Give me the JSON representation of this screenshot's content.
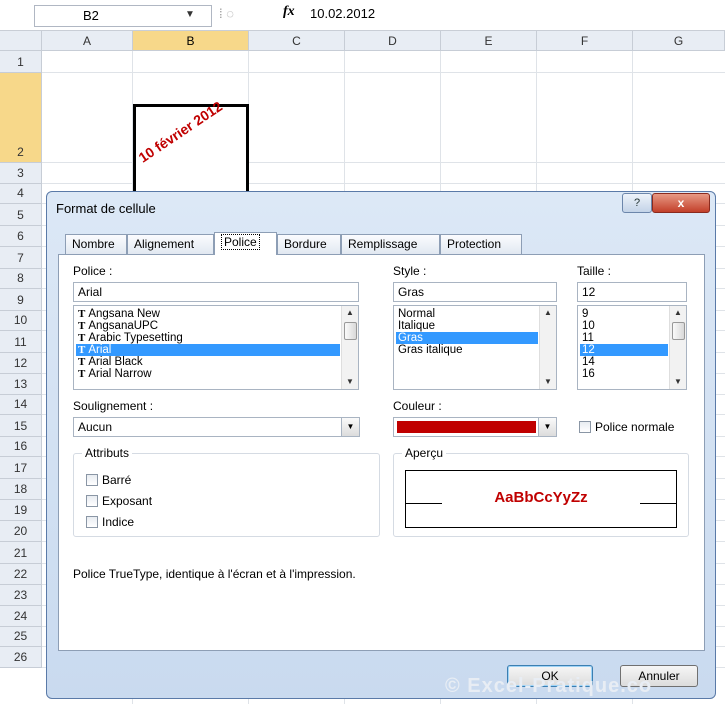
{
  "formula_bar": {
    "name_box": "B2",
    "fx_symbol": "fx",
    "formula": "10.02.2012"
  },
  "sheet": {
    "columns": [
      "A",
      "B",
      "C",
      "D",
      "E",
      "F",
      "G"
    ],
    "selected_column": "B",
    "rows": [
      "1",
      "2",
      "3",
      "4",
      "5",
      "6",
      "7",
      "8",
      "9",
      "10",
      "11",
      "12",
      "13",
      "14",
      "15",
      "16",
      "17",
      "18",
      "19",
      "20",
      "21",
      "22",
      "23",
      "24",
      "25",
      "26"
    ],
    "selected_row": "2",
    "cell_b2_text": "10 février 2012"
  },
  "dialog": {
    "title": "Format de cellule",
    "help": "?",
    "close": "x",
    "tabs": [
      "Nombre",
      "Alignement",
      "Police",
      "Bordure",
      "Remplissage",
      "Protection"
    ],
    "active_tab": "Police",
    "font": {
      "label": "Police :",
      "value": "Arial",
      "items": [
        "Angsana New",
        "AngsanaUPC",
        "Arabic Typesetting",
        "Arial",
        "Arial Black",
        "Arial Narrow"
      ],
      "selected": "Arial",
      "tt_glyph": "T"
    },
    "style": {
      "label": "Style :",
      "value": "Gras",
      "items": [
        "Normal",
        "Italique",
        "Gras",
        "Gras italique"
      ],
      "selected": "Gras"
    },
    "size": {
      "label": "Taille :",
      "value": "12",
      "items": [
        "9",
        "10",
        "11",
        "12",
        "14",
        "16"
      ],
      "selected": "12"
    },
    "underline": {
      "label": "Soulignement :",
      "value": "Aucun"
    },
    "color": {
      "label": "Couleur :",
      "value": "#c00000",
      "normal_label": "Police normale"
    },
    "attributes": {
      "label": "Attributs",
      "items": [
        "Barré",
        "Exposant",
        "Indice"
      ]
    },
    "preview": {
      "label": "Aperçu",
      "sample": "AaBbCcYyZz"
    },
    "info_text": "Police TrueType, identique à l'écran et à l'impression.",
    "ok": "OK",
    "cancel": "Annuler"
  },
  "watermark": "© Excel-Pratique.co",
  "colors": {
    "accent_red": "#c00000",
    "selection_blue": "#3399ff",
    "header_selected": "#f7d88a"
  }
}
